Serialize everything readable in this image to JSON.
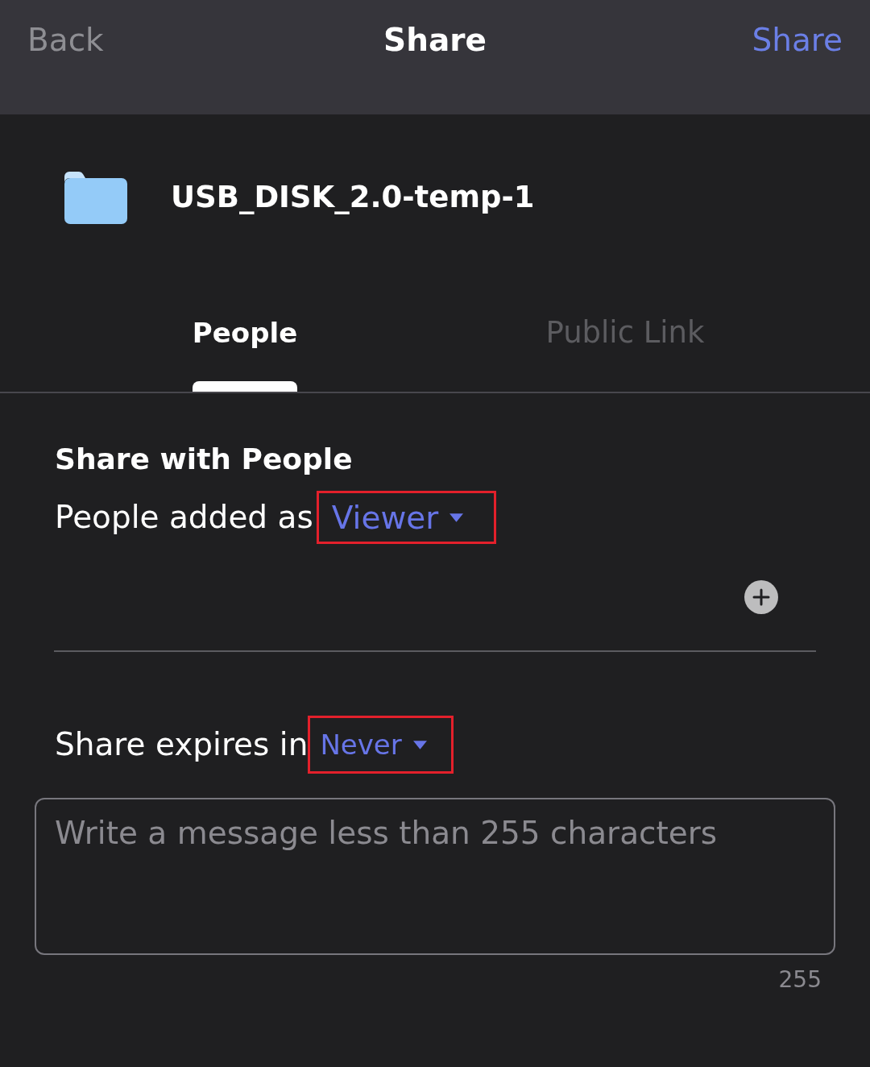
{
  "nav_bar": {
    "back": "Back",
    "title": "Share",
    "action": "Share"
  },
  "item": {
    "name": "USB_DISK_2.0-temp-1"
  },
  "tabs": [
    {
      "label": "People",
      "selected": true
    },
    {
      "label": "Public Link",
      "selected": false
    }
  ],
  "share_with_people": {
    "heading": "Share with People",
    "role": {
      "label": "People added as",
      "value": "Viewer",
      "highlighted": true
    }
  },
  "expiry": {
    "label": "Share expires in",
    "value": "Never",
    "highlighted": true
  },
  "message": {
    "placeholder": "Write a message less than 255 characters",
    "counter": "255"
  }
}
